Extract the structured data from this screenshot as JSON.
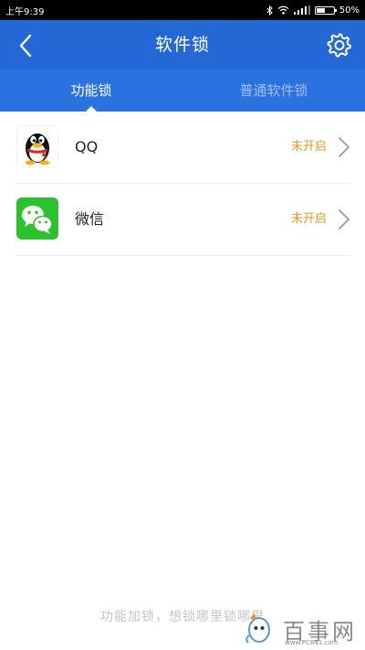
{
  "status_bar": {
    "time": "上午9:39",
    "battery": "50%",
    "battery_level": 0.5
  },
  "header": {
    "title": "软件锁",
    "back_icon": "chevron-left-icon",
    "settings_icon": "gear-icon"
  },
  "tabs": [
    {
      "label": "功能锁",
      "active": true
    },
    {
      "label": "普通软件锁",
      "active": false
    }
  ],
  "apps": [
    {
      "name": "QQ",
      "status": "未开启",
      "icon": "qq-penguin-icon"
    },
    {
      "name": "微信",
      "status": "未开启",
      "icon": "wechat-icon"
    }
  ],
  "footer": {
    "hint": "功能加锁，想锁哪里锁哪里"
  },
  "watermark": {
    "text": "百事网",
    "sub": "www.PC841.com"
  },
  "colors": {
    "header": "#2468d6",
    "tab_bar": "#2a72df",
    "status_text": "#e59b22"
  }
}
